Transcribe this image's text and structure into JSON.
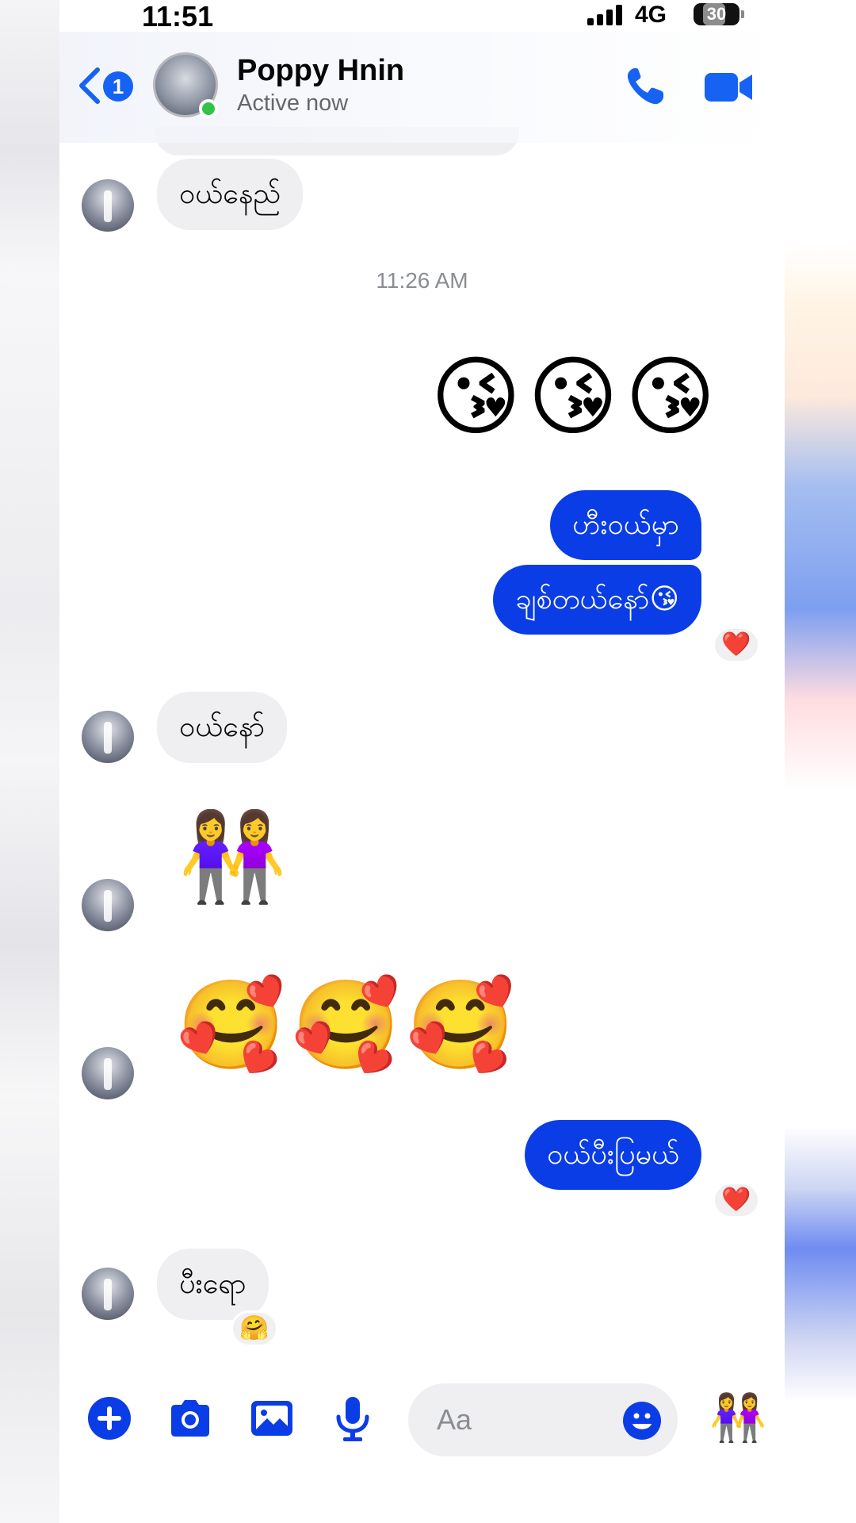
{
  "status_bar": {
    "time": "11:51",
    "network": "4G",
    "battery": "30"
  },
  "header": {
    "back_badge": "1",
    "contact_name": "Poppy Hnin",
    "contact_status": "Active now",
    "icons": [
      "back-chevron-icon",
      "phone-icon",
      "video-camera-icon"
    ]
  },
  "messages": {
    "m1": "ဝယ်နေည်",
    "timestamp": "11:26 AM",
    "m2_emoji": "😘😘😘",
    "m3": "ဟီးဝယ်မှာ",
    "m4": "ချစ်တယ်နော်😘",
    "m4_reaction": "❤️",
    "m5": "ဝယ်နော်",
    "m6_emoji": "👭",
    "m7_emoji": "🥰🥰🥰",
    "m8": "ဝယ်ပီးပြမယ်",
    "m8_reaction": "❤️",
    "m9": "ပီးရော",
    "m9_reaction": "🤗"
  },
  "composer": {
    "placeholder": "Aa",
    "like_emoji": "👭",
    "icons": [
      "plus-icon",
      "camera-icon",
      "gallery-icon",
      "microphone-icon",
      "smile-icon"
    ]
  },
  "colors": {
    "accent": "#1662f3",
    "outgoing_bubble": "#0a3de6",
    "incoming_bubble": "#efeff1",
    "online": "#31c24a"
  }
}
